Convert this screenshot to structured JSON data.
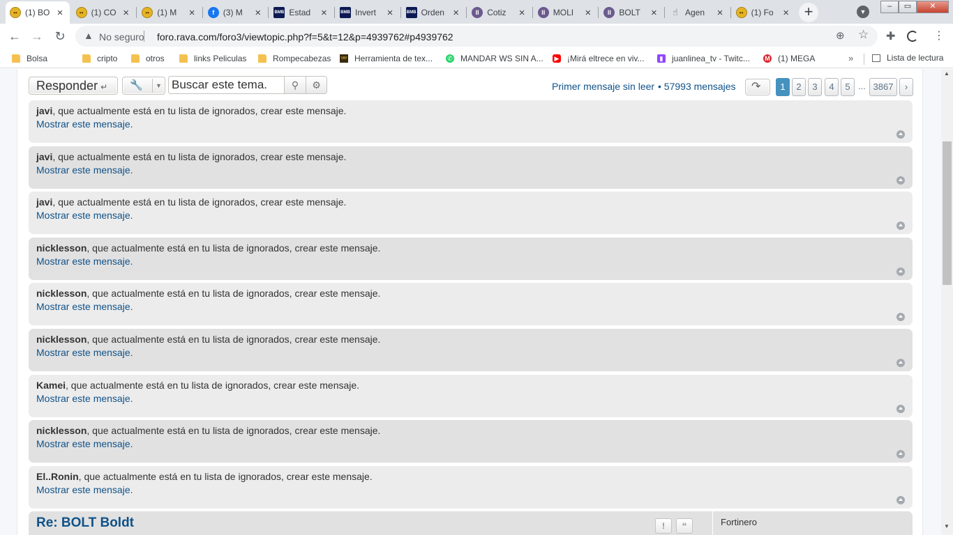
{
  "browser": {
    "tabs": [
      {
        "title": "(1) BO",
        "favicon": "emoji-face-icon"
      },
      {
        "title": "(1) CO",
        "favicon": "emoji-face-icon"
      },
      {
        "title": "(1) M",
        "favicon": "emoji-face-icon"
      },
      {
        "title": "(3) M",
        "favicon": "facebook-icon"
      },
      {
        "title": "Estad",
        "favicon": "bmb-icon"
      },
      {
        "title": "Invert",
        "favicon": "bmb-icon"
      },
      {
        "title": "Orden",
        "favicon": "bmb-icon"
      },
      {
        "title": "Cotiz",
        "favicon": "iol-icon"
      },
      {
        "title": "MOLI",
        "favicon": "iol-icon"
      },
      {
        "title": "BOLT",
        "favicon": "iol-icon"
      },
      {
        "title": "Agen",
        "favicon": "hand-icon"
      },
      {
        "title": "(1) Fo",
        "favicon": "emoji-face-icon"
      }
    ],
    "active_tab_index": 0,
    "security_label": "No seguro",
    "url": "foro.rava.com/foro3/viewtopic.php?f=5&t=12&p=4939762#p4939762",
    "bookmarks": [
      {
        "label": "Bolsa",
        "icon": "folder-icon"
      },
      {
        "label": "cripto",
        "icon": "folder-icon"
      },
      {
        "label": "otros",
        "icon": "folder-icon"
      },
      {
        "label": "links Peliculas",
        "icon": "folder-icon"
      },
      {
        "label": "Rompecabezas",
        "icon": "folder-icon"
      },
      {
        "label": "Herramienta de tex...",
        "icon": "yaytext-icon"
      },
      {
        "label": "MANDAR WS SIN A...",
        "icon": "whatsapp-icon"
      },
      {
        "label": "¡Mirá eltrece en viv...",
        "icon": "youtube-icon"
      },
      {
        "label": "juanlinea_tv - Twitc...",
        "icon": "twitch-icon"
      },
      {
        "label": "(1) MEGA",
        "icon": "mega-icon"
      }
    ],
    "more_bookmarks": "»",
    "reading_list": "Lista de lectura"
  },
  "actions": {
    "reply_label": "Responder",
    "search_placeholder": "Buscar este tema.",
    "first_unread": "Primer mensaje sin leer",
    "bullet": "•",
    "message_count": "57993 mensajes",
    "pages": [
      "1",
      "2",
      "3",
      "4",
      "5"
    ],
    "ellipsis": "...",
    "last_page": "3867",
    "current_page": "1"
  },
  "ignored_text": ", que actualmente está en tu lista de ignorados, crear este mensaje.",
  "show_message": "Mostrar este mensaje.",
  "ignored_posts": [
    {
      "user": "javi",
      "shade": "light"
    },
    {
      "user": "javi",
      "shade": "dark"
    },
    {
      "user": "javi",
      "shade": "light"
    },
    {
      "user": "nicklesson",
      "shade": "dark"
    },
    {
      "user": "nicklesson",
      "shade": "light"
    },
    {
      "user": "nicklesson",
      "shade": "dark"
    },
    {
      "user": "Kamei",
      "shade": "light"
    },
    {
      "user": "nicklesson",
      "shade": "dark"
    },
    {
      "user": "El..Ronin",
      "shade": "light"
    }
  ],
  "last_post": {
    "title": "Re: BOLT Boldt",
    "report_label": "!",
    "quote_label": "“",
    "author": "Fortinero"
  },
  "colors": {
    "link": "#105289",
    "post_bg_light": "#ececec",
    "post_bg_dark": "#e1e1e1",
    "pagination_active": "#4692bf"
  }
}
